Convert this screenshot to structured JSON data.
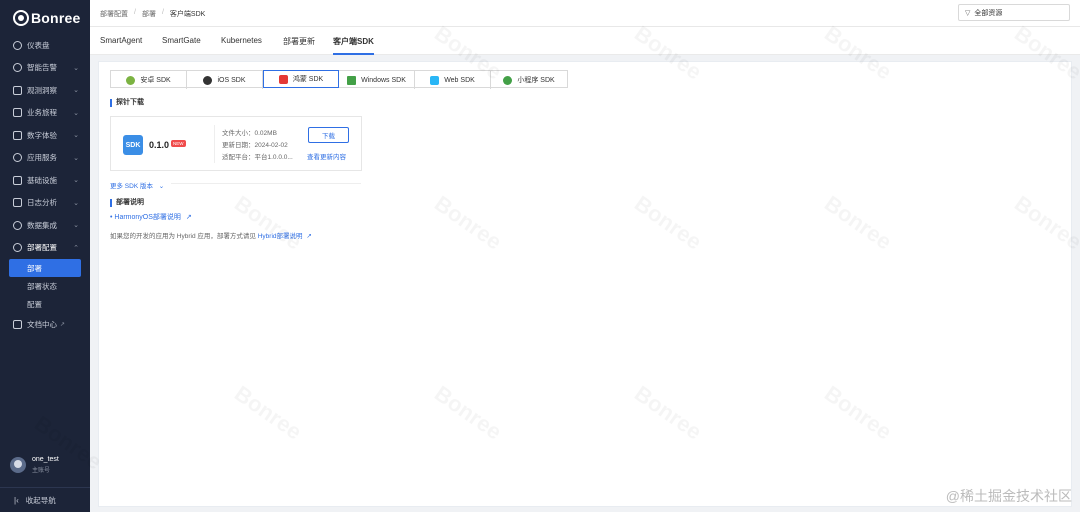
{
  "brand": {
    "name": "Bonree"
  },
  "sidebar": {
    "items": [
      {
        "label": "仪表盘",
        "icon": "dashboard-icon",
        "chevron": false
      },
      {
        "label": "智能告警",
        "icon": "alarm-icon",
        "chevron": true
      },
      {
        "label": "观测洞察",
        "icon": "insight-icon",
        "chevron": true
      },
      {
        "label": "业务旅程",
        "icon": "journey-icon",
        "chevron": true
      },
      {
        "label": "数字体验",
        "icon": "experience-icon",
        "chevron": true
      },
      {
        "label": "应用服务",
        "icon": "app-service-icon",
        "chevron": true
      },
      {
        "label": "基础设施",
        "icon": "infrastructure-icon",
        "chevron": true
      },
      {
        "label": "日志分析",
        "icon": "log-icon",
        "chevron": true
      },
      {
        "label": "数据集成",
        "icon": "data-integration-icon",
        "chevron": true
      },
      {
        "label": "部署配置",
        "icon": "deploy-config-icon",
        "chevron": true,
        "expanded": true
      }
    ],
    "subitems": [
      {
        "label": "部署",
        "active": true
      },
      {
        "label": "部署状态",
        "active": false
      },
      {
        "label": "配置",
        "active": false
      }
    ],
    "docs": {
      "label": "文档中心"
    },
    "user": {
      "name": "one_test",
      "role": "主账号"
    },
    "collapse_label": "收起导航"
  },
  "breadcrumb": [
    "部署配置",
    "部署",
    "客户端SDK"
  ],
  "resource_select": {
    "value": "全部资源"
  },
  "tabs": [
    "SmartAgent",
    "SmartGate",
    "Kubernetes",
    "部署更新",
    "客户端SDK"
  ],
  "active_tab": "客户端SDK",
  "platforms": [
    {
      "label": "安卓 SDK",
      "icon": "android-icon",
      "color": "#7cb342"
    },
    {
      "label": "iOS SDK",
      "icon": "apple-icon",
      "color": "#333333"
    },
    {
      "label": "鸿蒙 SDK",
      "icon": "harmony-icon",
      "color": "#e53935",
      "active": true
    },
    {
      "label": "Windows SDK",
      "icon": "windows-icon",
      "color": "#43a047"
    },
    {
      "label": "Web SDK",
      "icon": "web-icon",
      "color": "#29b6f6"
    },
    {
      "label": "小程序 SDK",
      "icon": "miniprogram-icon",
      "color": "#43a047"
    }
  ],
  "probe": {
    "title": "探针下载",
    "version": "0.1.0",
    "badge": "NEW",
    "icon_text": "SDK",
    "size": "文件大小：0.02MB",
    "date": "更新日期：2024-02-02",
    "platform": "适配平台：平台1.0.0.0...",
    "download_label": "下载",
    "update_link": "查看更新内容"
  },
  "more_versions": "更多 SDK 版本",
  "deploy": {
    "title": "部署说明",
    "link": "HarmonyOS部署说明",
    "note_prefix": "如果您的开发的应用为 Hybrid 应用，部署方式请见",
    "note_link": "Hybrid部署说明"
  },
  "watermark": "Bonree",
  "corner": "@稀土掘金技术社区"
}
